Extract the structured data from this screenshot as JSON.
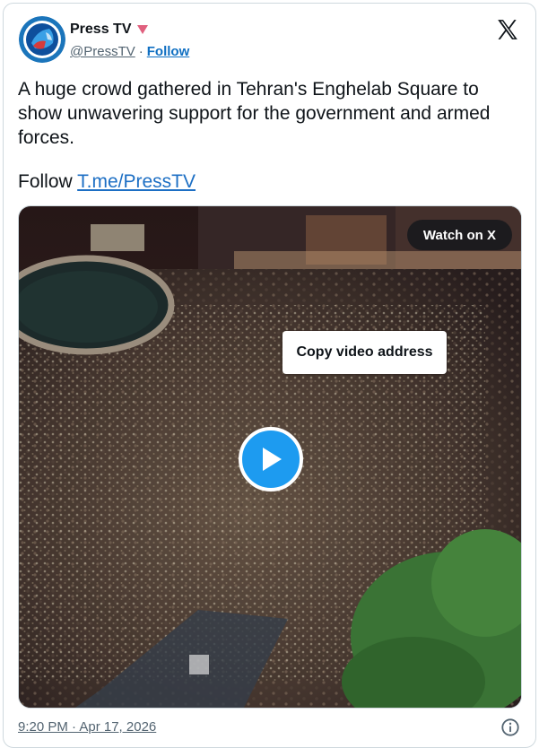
{
  "author": {
    "name": "Press TV",
    "handle": "@PressTV",
    "separator": "·",
    "follow_label": "Follow",
    "avatar_icon": "presstv-logo-icon",
    "badge_icon": "heart-badge-icon",
    "badge_color": "#e0245e"
  },
  "brand_icon": "x-logo-icon",
  "tweet": {
    "text": "A huge crowd gathered in Tehran's Enghelab Square to show unwavering support for the government and armed forces.",
    "follow_prefix": "Follow",
    "follow_link": "T.me/PressTV"
  },
  "media": {
    "watch_label": "Watch on X",
    "tooltip": "Copy video address",
    "play_icon": "play-icon",
    "accent": "#1d9bf0"
  },
  "footer": {
    "timestamp": "9:20 PM · Apr 17, 2026",
    "info_icon": "info-icon"
  }
}
